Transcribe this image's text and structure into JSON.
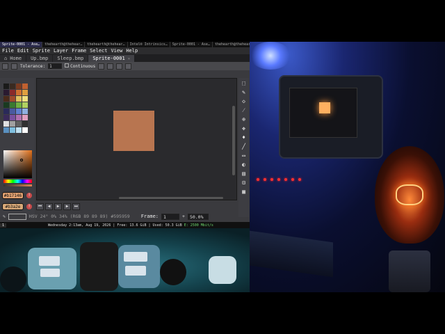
{
  "wm_tabs": [
    "Sprite-0001 - Ase…",
    "thehearth@thehear…",
    "thehearth@thehear…",
    "Intel® Intrinsics…",
    "Sprite-0001 - Ase…",
    "thehearth@thehear…"
  ],
  "menu": [
    "File",
    "Edit",
    "Sprite",
    "Layer",
    "Frame",
    "Select",
    "View",
    "Help"
  ],
  "doc_tabs": [
    {
      "label": "Home",
      "icon": "home-icon"
    },
    {
      "label": "Up.bmp"
    },
    {
      "label": "Sleep.bmp"
    },
    {
      "label": "Sprite-0001",
      "active": true
    }
  ],
  "context_bar": {
    "tolerance_label": "Tolerance:",
    "tolerance_value": "1",
    "continuous_label": "Continuous"
  },
  "palette_colors": [
    "#1a1a1a",
    "#3a2a20",
    "#7a3a20",
    "#c06030",
    "#2a1a30",
    "#8a2a2a",
    "#d07030",
    "#e0a040",
    "#4a2a1a",
    "#a04a2a",
    "#e0c060",
    "#f0e080",
    "#1a3a20",
    "#3a7a30",
    "#70b040",
    "#b0d060",
    "#2a2a5a",
    "#4a5aa0",
    "#6080d0",
    "#90b0e0",
    "#3a2a5a",
    "#7a50a0",
    "#b070b0",
    "#e0a0c0",
    "#e0e0e0",
    "#a0a0a0",
    "#606060",
    "#303030",
    "#5a90c0",
    "#80c0e0",
    "#c0e0f0",
    "#ffffff"
  ],
  "foreground_hex": "#b17146",
  "background_hex": "#b3a2e",
  "status": {
    "pixel_info": "HSV 24° 0% 34% (RGB 89 89 89) #595959",
    "frame_label": "Frame:",
    "frame_value": "1",
    "zoom": "50.0%"
  },
  "sysbar": {
    "workspace": "1",
    "clock": "Wednesday 2:13am, Aug 19, 2026",
    "free": "Free: 13.6 GiB",
    "used": "Used: 50.3 GiB",
    "net": "E: 2500 Mbit/s"
  },
  "colors": {
    "sprite_fill": "#b87550",
    "accent_warning": "#c84b4b"
  }
}
